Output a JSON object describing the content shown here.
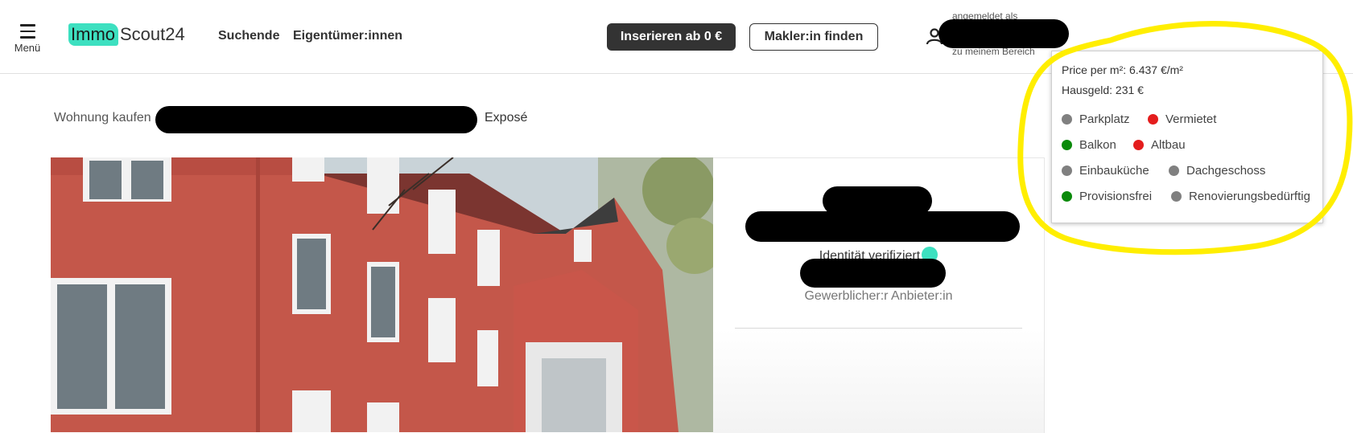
{
  "header": {
    "menu_label": "Menü",
    "logo_part1": "Immo",
    "logo_part2": "Scout24",
    "nav_seekers": "Suchende",
    "nav_owners": "Eigentümer:innen",
    "btn_list": "Inserieren ab 0 €",
    "btn_find_agent": "Makler:in finden",
    "user_logged_in": "angemeldet als",
    "user_area": "zu meinem Bereich"
  },
  "breadcrumb": {
    "first": "Wohnung kaufen",
    "last": "Exposé"
  },
  "agent": {
    "verified": "Identität verifiziert",
    "type": "Gewerblicher:r Anbieter:in"
  },
  "popup": {
    "price_per_sqm": "Price per m²: 6.437 €/m²",
    "hausgeld": "Hausgeld: 231 €",
    "features": [
      {
        "label": "Parkplatz",
        "status": "grey"
      },
      {
        "label": "Vermietet",
        "status": "red"
      },
      {
        "label": "Balkon",
        "status": "green"
      },
      {
        "label": "Altbau",
        "status": "red"
      },
      {
        "label": "Einbauküche",
        "status": "grey"
      },
      {
        "label": "Dachgeschoss",
        "status": "grey"
      },
      {
        "label": "Provisionsfrei",
        "status": "green"
      },
      {
        "label": "Renovierungsbedürftig",
        "status": "grey"
      }
    ]
  },
  "colors": {
    "brand_teal": "#3de0c0",
    "status_green": "#0a8a0a",
    "status_red": "#e41d1d",
    "status_grey": "#808080",
    "highlight": "#ffee00"
  }
}
